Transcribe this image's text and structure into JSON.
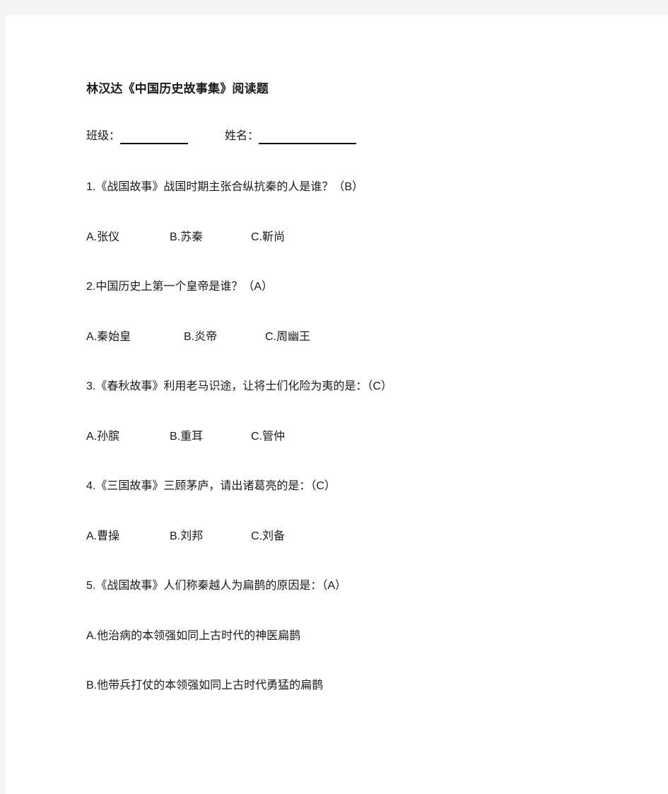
{
  "document": {
    "title": "林汉达《中国历史故事集》阅读题",
    "identity": {
      "class_label": "班级：",
      "class_value": "",
      "name_label": "姓名：",
      "name_value": ""
    },
    "questions": [
      {
        "number": "1.",
        "text": "1.《战国故事》战国时期主张合纵抗秦的人是谁？（B）",
        "answer": "B",
        "option_layout": "narrow",
        "options": [
          "A.张仪",
          "B.苏秦",
          "C.靳尚"
        ]
      },
      {
        "number": "2.",
        "text": "2.中国历史上第一个皇帝是谁？（A）",
        "answer": "A",
        "option_layout": "wide",
        "options": [
          "A.秦始皇",
          "B.炎帝",
          "C.周幽王"
        ]
      },
      {
        "number": "3.",
        "text": "3.《春秋故事》利用老马识途，让将士们化险为夷的是：（C）",
        "answer": "C",
        "option_layout": "narrow",
        "options": [
          "A.孙膑",
          "B.重耳",
          "C.管仲"
        ]
      },
      {
        "number": "4.",
        "text": "4.《三国故事》三顾茅庐，请出诸葛亮的是：（C）",
        "answer": "C",
        "option_layout": "narrow",
        "options": [
          "A.曹操",
          "B.刘邦",
          "C.刘备"
        ]
      },
      {
        "number": "5.",
        "text": "5.《战国故事》人们称秦越人为扁鹊的原因是：（A）",
        "answer": "A",
        "option_layout": "stacked",
        "options": [
          "A.他治病的本领强如同上古时代的神医扁鹊",
          "B.他带兵打仗的本领强如同上古时代勇猛的扁鹊"
        ]
      }
    ]
  },
  "colors": {
    "page_background": "#f4f4f4",
    "sheet_background": "#ffffff",
    "text": "#1a1a1a",
    "rule": "#000000"
  }
}
